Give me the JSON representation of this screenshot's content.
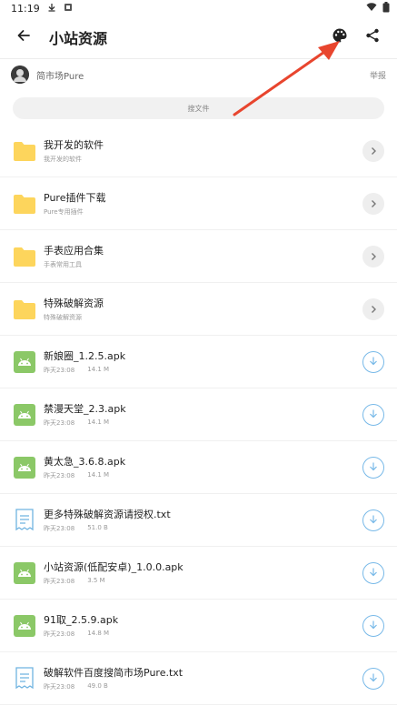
{
  "status_bar": {
    "time": "11:19"
  },
  "app_bar": {
    "title": "小站资源"
  },
  "author": {
    "name": "简市场Pure",
    "report_label": "举报"
  },
  "search": {
    "placeholder": "搜文件"
  },
  "folders": [
    {
      "name": "我开发的软件",
      "desc": "我开发的软件"
    },
    {
      "name": "Pure插件下载",
      "desc": "Pure专用插件"
    },
    {
      "name": "手表应用合集",
      "desc": "手表常用工具"
    },
    {
      "name": "特殊破解资源",
      "desc": "特殊破解资源"
    }
  ],
  "files": [
    {
      "name": "新娘圈_1.2.5.apk",
      "date": "昨天23:08",
      "size": "14.1 M",
      "type": "apk"
    },
    {
      "name": "禁漫天堂_2.3.apk",
      "date": "昨天23:08",
      "size": "14.1 M",
      "type": "apk"
    },
    {
      "name": "黄太急_3.6.8.apk",
      "date": "昨天23:08",
      "size": "14.1 M",
      "type": "apk"
    },
    {
      "name": "更多特殊破解资源请授权.txt",
      "date": "昨天23:08",
      "size": "51.0 B",
      "type": "txt"
    },
    {
      "name": "小站资源(低配安卓)_1.0.0.apk",
      "date": "昨天23:08",
      "size": "3.5 M",
      "type": "apk"
    },
    {
      "name": "91取_2.5.9.apk",
      "date": "昨天23:08",
      "size": "14.8 M",
      "type": "apk"
    },
    {
      "name": "破解软件百度搜简市场Pure.txt",
      "date": "昨天23:08",
      "size": "49.0 B",
      "type": "txt"
    }
  ],
  "colors": {
    "folder": "#fdd55c",
    "apk": "#8bc867",
    "txt_outline": "#6fb3e0",
    "download": "#78b9e8",
    "annotation_arrow": "#e8452e"
  },
  "icons": {
    "back": "arrow-left-icon",
    "theme": "palette-icon",
    "share": "share-icon",
    "folder": "folder-icon",
    "apk": "android-apk-icon",
    "txt": "text-document-icon",
    "chevron": "chevron-right-icon",
    "download": "download-icon"
  }
}
